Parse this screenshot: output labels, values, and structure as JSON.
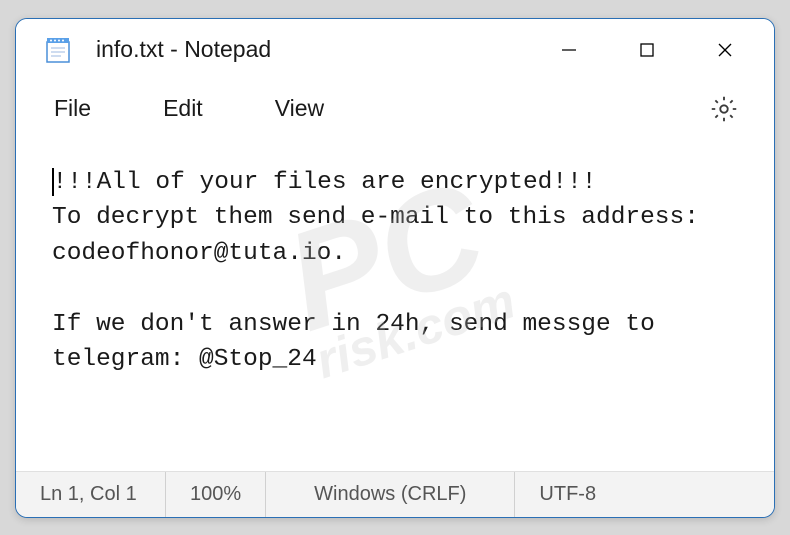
{
  "titlebar": {
    "title": "info.txt - Notepad"
  },
  "menubar": {
    "file": "File",
    "edit": "Edit",
    "view": "View"
  },
  "editor": {
    "line1": "!!!All of your files are encrypted!!!",
    "line2": "To decrypt them send e-mail to this address: codeofhonor@tuta.io.",
    "line3": "If we don't answer in 24h, send messge to telegram: @Stop_24"
  },
  "statusbar": {
    "position": "Ln 1, Col 1",
    "zoom": "100%",
    "line_ending": "Windows (CRLF)",
    "encoding": "UTF-8"
  },
  "watermark": {
    "main": "PC",
    "sub": "risk.com"
  }
}
